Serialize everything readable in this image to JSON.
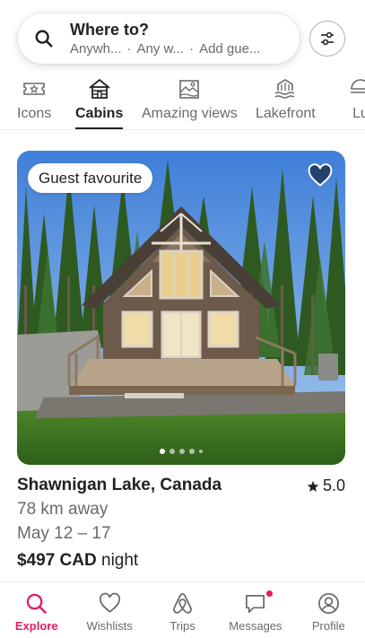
{
  "search": {
    "title": "Where to?",
    "where": "Anywh...",
    "when": "Any w...",
    "who": "Add gue...",
    "separator": "·",
    "search_icon": "search-icon",
    "filter_icon": "filter-sliders-icon"
  },
  "categories": [
    {
      "label": "Icons",
      "icon": "icons-ticket-icon",
      "active": false
    },
    {
      "label": "Cabins",
      "icon": "cabin-icon",
      "active": true
    },
    {
      "label": "Amazing views",
      "icon": "amazing-views-icon",
      "active": false
    },
    {
      "label": "Lakefront",
      "icon": "lakefront-icon",
      "active": false
    },
    {
      "label": "Lu",
      "icon": "luxe-icon",
      "active": false
    }
  ],
  "listing": {
    "badge": "Guest favourite",
    "title": "Shawnigan Lake, Canada",
    "rating": "5.0",
    "distance": "78 km away",
    "dates": "May 12 – 17",
    "price": "$497 CAD",
    "price_unit": " night",
    "photo_count_dots": 5,
    "active_dot": 0,
    "wishlist_icon": "heart-icon",
    "rating_icon": "star-icon"
  },
  "nav": [
    {
      "label": "Explore",
      "icon": "search-icon",
      "active": true
    },
    {
      "label": "Wishlists",
      "icon": "heart-outline-icon",
      "active": false
    },
    {
      "label": "Trips",
      "icon": "airbnb-logo-icon",
      "active": false
    },
    {
      "label": "Messages",
      "icon": "message-icon",
      "active": false,
      "notification": true
    },
    {
      "label": "Profile",
      "icon": "profile-icon",
      "active": false
    }
  ],
  "colors": {
    "accent": "#e31c5f",
    "text_primary": "#222222",
    "text_secondary": "#6a6a6a"
  }
}
